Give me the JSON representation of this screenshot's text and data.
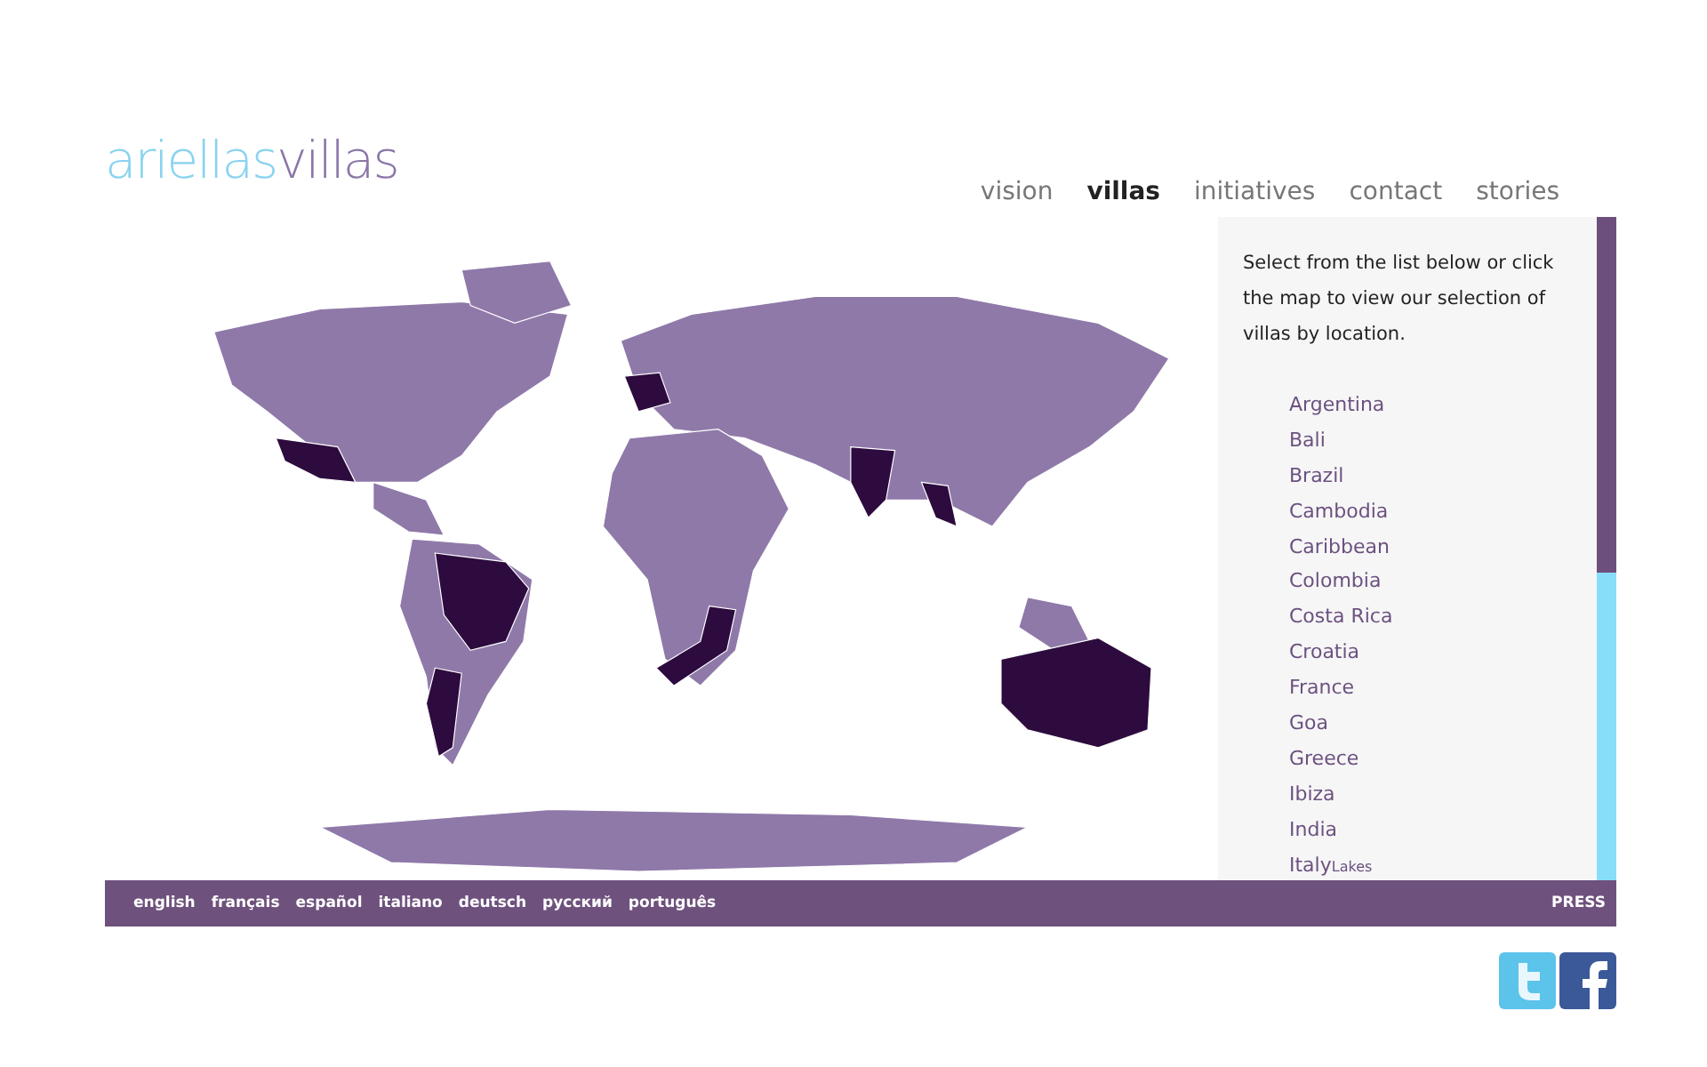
{
  "logo": {
    "part_1": "ariellas",
    "part_2": "villas"
  },
  "nav": [
    {
      "label": "vision",
      "selected": false
    },
    {
      "label": "villas",
      "selected": true
    },
    {
      "label": "initiatives",
      "selected": false
    },
    {
      "label": "contact",
      "selected": false
    },
    {
      "label": "stories",
      "selected": false
    }
  ],
  "sidebar": {
    "intro": "Select from the list below or click the map to view our selection of villas by location.",
    "locations": [
      {
        "name": "Argentina"
      },
      {
        "name": "Bali"
      },
      {
        "name": "Brazil"
      },
      {
        "name": "Cambodia"
      },
      {
        "name": "Caribbean"
      },
      {
        "name": "Colombia"
      },
      {
        "name": "Costa Rica"
      },
      {
        "name": "Croatia"
      },
      {
        "name": "France"
      },
      {
        "name": "Goa"
      },
      {
        "name": "Greece"
      },
      {
        "name": "Ibiza"
      },
      {
        "name": "India"
      },
      {
        "name": "Italy",
        "note": "Lakes"
      }
    ]
  },
  "footer": {
    "languages": [
      "english",
      "français",
      "español",
      "italiano",
      "deutsch",
      "русский",
      "português"
    ],
    "press": "PRESS"
  }
}
